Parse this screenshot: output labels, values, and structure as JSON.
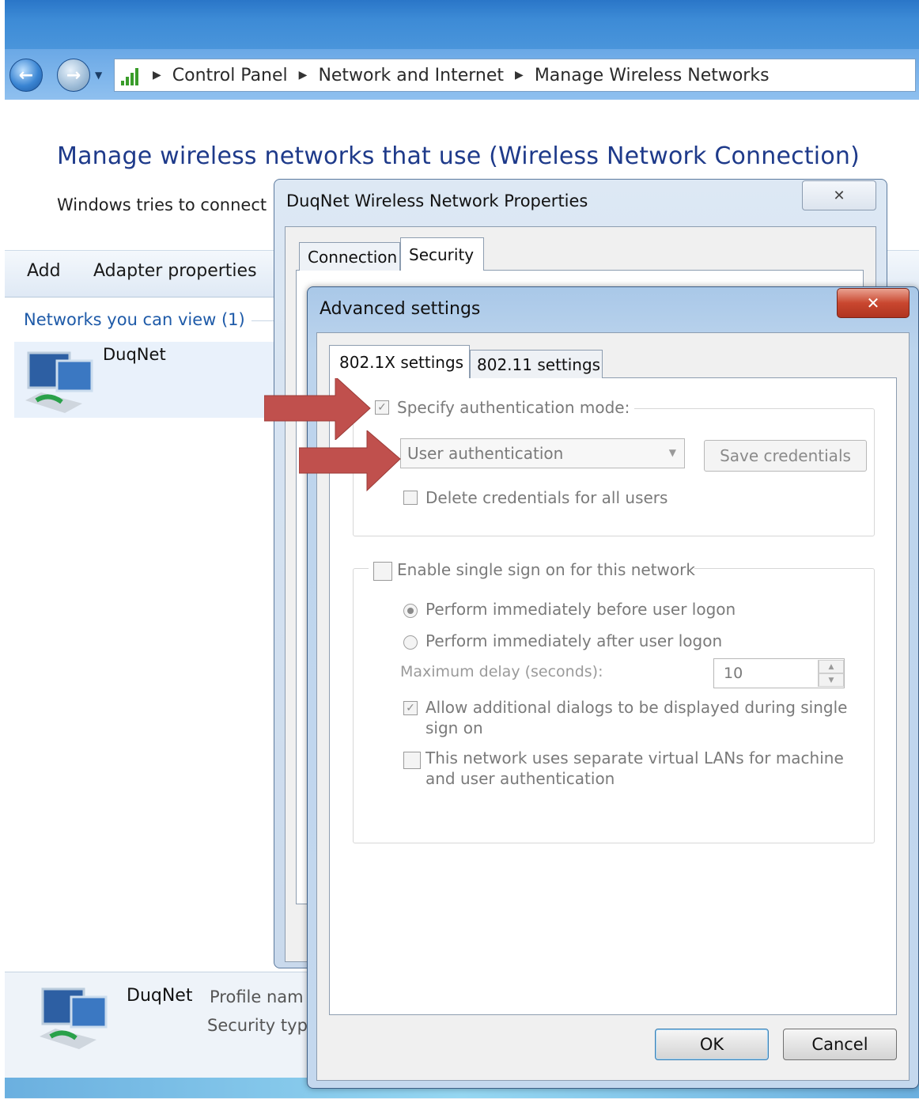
{
  "breadcrumb": [
    "Control Panel",
    "Network and Internet",
    "Manage Wireless Networks"
  ],
  "main": {
    "heading": "Manage wireless networks that use (Wireless Network Connection)",
    "subtext": "Windows tries to connect",
    "toolbar": {
      "add": "Add",
      "adapter": "Adapter properties"
    },
    "networks_header": "Networks you can view (1)",
    "network_name": "DuqNet",
    "details": {
      "name": "DuqNet",
      "line1": "Profile nam",
      "line2": "Security typ"
    }
  },
  "props_dialog": {
    "title": "DuqNet Wireless Network Properties",
    "close": "✕",
    "tabs": [
      "Connection",
      "Security"
    ]
  },
  "adv_dialog": {
    "title": "Advanced settings",
    "close": "✕",
    "tabs": [
      "802.1X settings",
      "802.11 settings"
    ],
    "specify_auth": {
      "label": "Specify authentication mode:",
      "checked": true
    },
    "auth_mode": "User authentication",
    "save_credentials": "Save credentials",
    "delete_credentials": {
      "label": "Delete credentials for all users",
      "checked": false
    },
    "sso": {
      "label": "Enable single sign on for this network",
      "checked": false
    },
    "radio_before": {
      "label": "Perform immediately before user logon",
      "selected": true
    },
    "radio_after": {
      "label": "Perform immediately after user logon",
      "selected": false
    },
    "max_delay_label": "Maximum delay (seconds):",
    "max_delay_value": "10",
    "allow_dialogs": {
      "line1": "Allow additional dialogs to be displayed during single",
      "line2": "sign on",
      "checked": true
    },
    "separate_vlans": {
      "line1": "This network uses separate virtual LANs for machine",
      "line2": "and user authentication",
      "checked": false
    },
    "ok": "OK",
    "cancel": "Cancel"
  },
  "colors": {
    "arrow": "#c0504d",
    "heading": "#1e3a8a",
    "link": "#1e5aa8"
  }
}
